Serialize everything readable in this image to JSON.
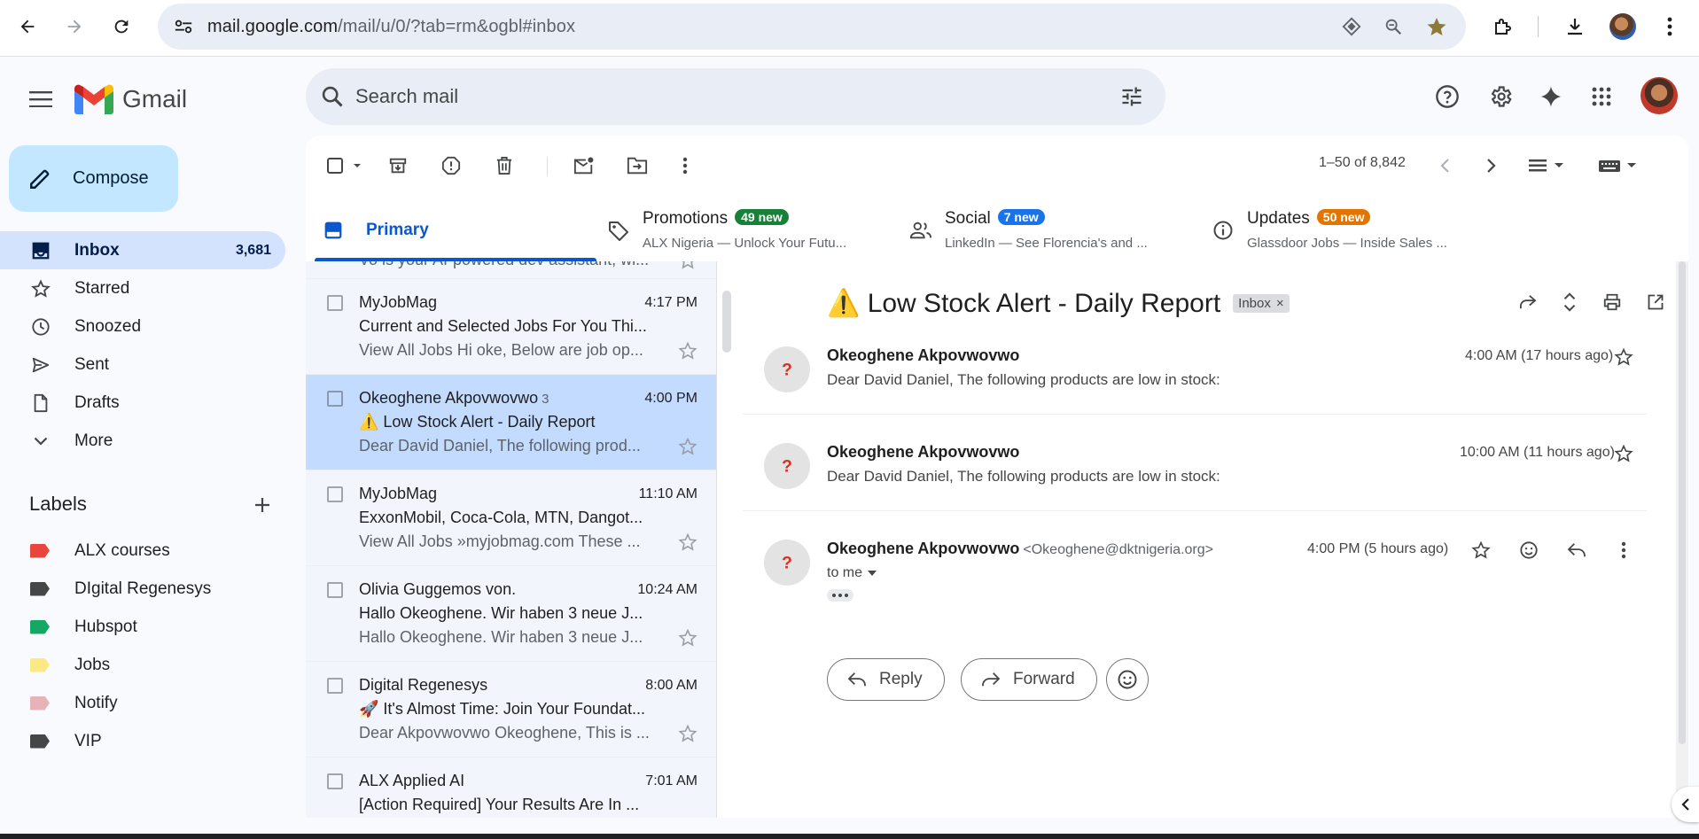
{
  "browser": {
    "url_host": "mail.google.com",
    "url_path": "/mail/u/0/?tab=rm&ogbl#inbox"
  },
  "app": {
    "logo_text": "Gmail",
    "search_placeholder": "Search mail"
  },
  "sidebar": {
    "compose_label": "Compose",
    "items": [
      {
        "label": "Inbox",
        "count": "3,681",
        "icon": "inbox-icon"
      },
      {
        "label": "Starred",
        "count": "",
        "icon": "star-icon"
      },
      {
        "label": "Snoozed",
        "count": "",
        "icon": "clock-icon"
      },
      {
        "label": "Sent",
        "count": "",
        "icon": "send-icon"
      },
      {
        "label": "Drafts",
        "count": "",
        "icon": "draft-icon"
      },
      {
        "label": "More",
        "count": "",
        "icon": "chevron-down-icon"
      }
    ],
    "labels_title": "Labels",
    "labels": [
      {
        "label": "ALX courses",
        "color": "#e8453c"
      },
      {
        "label": "DIgital Regenesys",
        "color": "#444746"
      },
      {
        "label": "Hubspot",
        "color": "#16a765"
      },
      {
        "label": "Jobs",
        "color": "#fbe983"
      },
      {
        "label": "Notify",
        "color": "#e6b4b8"
      },
      {
        "label": "VIP",
        "color": "#444746"
      }
    ]
  },
  "toolbar": {
    "pagination": "1–50 of 8,842"
  },
  "tabs": [
    {
      "name": "Primary",
      "badge": "",
      "snippet": "",
      "badge_color": ""
    },
    {
      "name": "Promotions",
      "badge": "49 new",
      "snippet": "ALX Nigeria — Unlock Your Futu...",
      "badge_color": "#188038"
    },
    {
      "name": "Social",
      "badge": "7 new",
      "snippet": "LinkedIn — See Florencia's and ...",
      "badge_color": "#1a73e8"
    },
    {
      "name": "Updates",
      "badge": "50 new",
      "snippet": "Glassdoor Jobs — Inside Sales ...",
      "badge_color": "#e37400"
    }
  ],
  "list": {
    "partial_snippet": "Vo is your AI-powered dev assistant, wi...",
    "rows": [
      {
        "sender": "MyJobMag",
        "count": "",
        "time": "4:17 PM",
        "subject": "Current and Selected Jobs For You Thi...",
        "snippet": "View All Jobs Hi oke, Below are job op..."
      },
      {
        "sender": "Okeoghene Akpovwovwo",
        "count": "3",
        "time": "4:00 PM",
        "subject": "⚠️ Low Stock Alert - Daily Report",
        "snippet": "Dear David Daniel, The following prod..."
      },
      {
        "sender": "MyJobMag",
        "count": "",
        "time": "11:10 AM",
        "subject": "ExxonMobil, Coca-Cola, MTN, Dangot...",
        "snippet": "View All Jobs »myjobmag.com These ..."
      },
      {
        "sender": "Olivia Guggemos von.",
        "count": "",
        "time": "10:24 AM",
        "subject": "Hallo Okeoghene. Wir haben 3 neue J...",
        "snippet": "Hallo Okeoghene. Wir haben 3 neue J..."
      },
      {
        "sender": "Digital Regenesys",
        "count": "",
        "time": "8:00 AM",
        "subject": "🚀 It's Almost Time: Join Your Foundat...",
        "snippet": "Dear Akpovwovwo Okeoghene, This is ..."
      },
      {
        "sender": "ALX Applied AI",
        "count": "",
        "time": "7:01 AM",
        "subject": "[Action Required] Your Results Are In ...",
        "snippet": ""
      }
    ]
  },
  "thread": {
    "subject": "⚠️ Low Stock Alert - Daily Report",
    "label_chip": "Inbox",
    "messages": [
      {
        "from": "Okeoghene Akpovwovwo",
        "address": "",
        "time": "4:00 AM (17 hours ago)",
        "preview": "Dear David Daniel, The following products are low in stock:"
      },
      {
        "from": "Okeoghene Akpovwovwo",
        "address": "",
        "time": "10:00 AM (11 hours ago)",
        "preview": "Dear David Daniel, The following products are low in stock:"
      },
      {
        "from": "Okeoghene Akpovwovwo",
        "address": "<Okeoghene@dktnigeria.org>",
        "time": "4:00 PM (5 hours ago)",
        "preview": ""
      }
    ],
    "to_me": "to me",
    "avatar_glyph": "?",
    "reply_label": "Reply",
    "forward_label": "Forward"
  }
}
